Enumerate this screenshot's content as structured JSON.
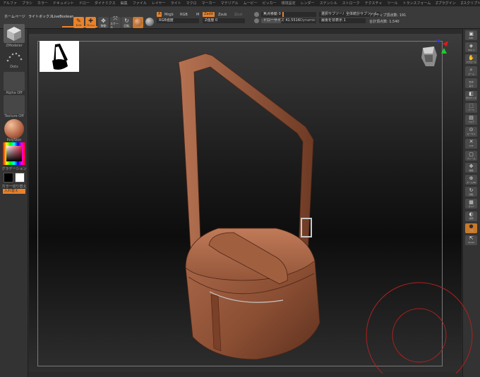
{
  "menu": [
    "アルファ",
    "ブラシ",
    "カラー",
    "ドキュメント",
    "ドロー",
    "ダイナミクス",
    "編集",
    "ファイル",
    "レイヤー",
    "ライト",
    "マクロ",
    "マーカー",
    "マテリアル",
    "ムービー",
    "ピッカー",
    "環境設定",
    "レンダー",
    "ステンシル",
    "ストローク",
    "テクスチャ",
    "ツール",
    "トランスフォーム",
    "Zプラグイン",
    "Zスクリプト",
    "ヘルプ"
  ],
  "topbar": {
    "home_page": "ホームページ",
    "lightbox": "ライトボックス",
    "live_boolean": "LiveBoolean",
    "tools": [
      {
        "icon": "edit",
        "glyph": "✎",
        "label": "Edit",
        "active": true
      },
      {
        "icon": "draw",
        "glyph": "✚",
        "label": "Draw",
        "active": true
      },
      {
        "icon": "move",
        "glyph": "✥",
        "label": "移動",
        "active": false
      },
      {
        "icon": "scale",
        "glyph": "⤧",
        "label": "スケール",
        "active": false
      },
      {
        "icon": "rotate",
        "glyph": "↻",
        "label": "回転",
        "active": false
      }
    ],
    "a_label": "A",
    "mrgb": "Mrgb",
    "rgb": "RGB",
    "m": "M",
    "rgb_intensity": "RGB強度",
    "zadd": "Zadd",
    "zsub": "Zsub",
    "zcut": "Zcut",
    "z_intensity": "Z強度 0",
    "focal_shift": "焦点移動 0",
    "draw_size": "ドローサイズ 41.5516",
    "dynamic": "Dynamic",
    "active_points": "アクティブ頂点数: 191",
    "total_points": "合計頂点数: 1,540",
    "subtool_poly": "選択サブツール",
    "subtool_all": "全体統計サブツール",
    "poly_label": "最後を非表示 1"
  },
  "leftpanel": {
    "zmodeler": "ZModeler",
    "dots": "Dots",
    "alpha_off": "Alpha Off",
    "texture_off": "Texture Off",
    "polyskin": "PolySkin",
    "gradient": "グラデーション",
    "switch_color": "カラー切り替え",
    "swap": "入れ替え"
  },
  "rightpanel": [
    {
      "icon": "bpr-icon",
      "label": "BPR"
    },
    {
      "icon": "spix-icon",
      "label": "SPix 3"
    },
    {
      "icon": "scroll-icon",
      "label": "スクロール"
    },
    {
      "icon": "zoom-icon",
      "label": "ズーム"
    },
    {
      "icon": "actual-icon",
      "label": "実寸"
    },
    {
      "icon": "aahalf-icon",
      "label": "半分サイズ"
    },
    {
      "icon": "persp-icon",
      "label": "パース"
    },
    {
      "icon": "floor-icon",
      "label": "フロア"
    },
    {
      "icon": "local-icon",
      "label": "ローカル"
    },
    {
      "icon": "xyz-icon",
      "label": "XYZ"
    },
    {
      "icon": "frame-icon",
      "label": "フレーム"
    },
    {
      "icon": "move-icon",
      "label": "移動"
    },
    {
      "icon": "zoom3d-icon",
      "label": "ズーム3D"
    },
    {
      "icon": "rotate-icon",
      "label": "回転"
    },
    {
      "icon": "polyf-icon",
      "label": "ポリF"
    },
    {
      "icon": "transp-icon",
      "label": "透明"
    },
    {
      "icon": "solo-icon",
      "label": "ソロ"
    },
    {
      "icon": "xpose-icon",
      "label": "Xpose"
    }
  ],
  "colors": {
    "accent": "#e8822b",
    "bag": "#9a5a3c",
    "strap": "#8e5036"
  }
}
